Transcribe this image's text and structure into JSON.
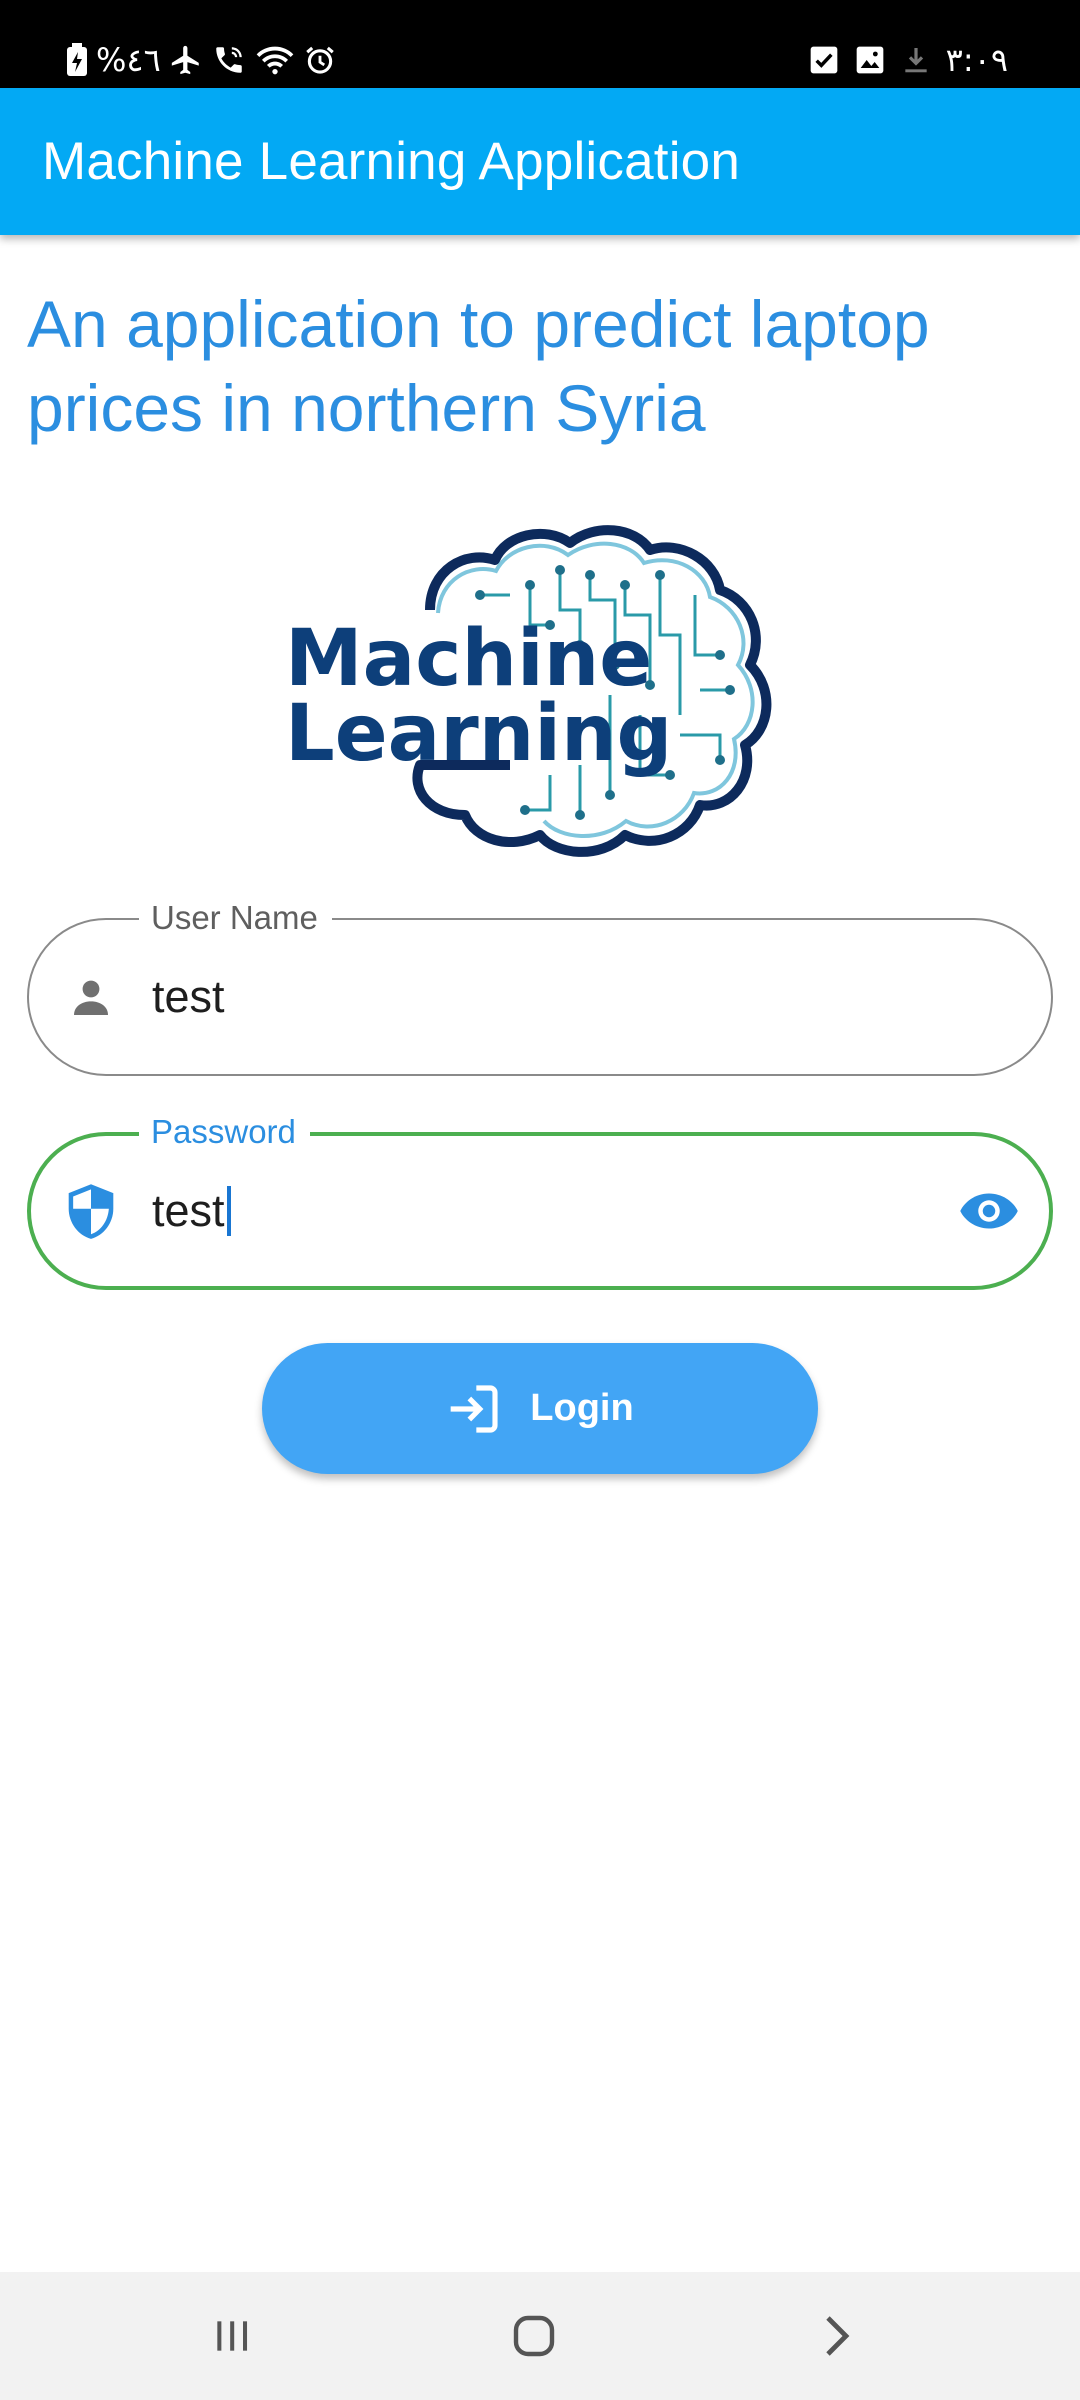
{
  "status_bar": {
    "battery_percent": "%٤٦",
    "time": "٣:٠٩",
    "left_icons": [
      "battery-charging-icon",
      "airplane-icon",
      "wifi-calling-icon",
      "wifi-icon",
      "alarm-icon"
    ],
    "right_icons": [
      "checkbox-notification-icon",
      "image-notification-icon",
      "download-notification-icon"
    ]
  },
  "app_bar": {
    "title": "Machine Learning Application",
    "color": "#03a9f4"
  },
  "intro": {
    "heading": "An application to predict laptop prices in northern Syria",
    "color": "#2b8ee0"
  },
  "logo": {
    "line1": "Machine",
    "line2": "Learning"
  },
  "form": {
    "username": {
      "label": "User Name",
      "value": "test",
      "icon": "person-icon"
    },
    "password": {
      "label": "Password",
      "value": "test",
      "icon": "shield-icon",
      "toggle_icon": "eye-icon",
      "focused": true,
      "border_color": "#4caf50"
    },
    "login": {
      "label": "Login",
      "icon": "login-icon",
      "color": "#42a5f5"
    }
  },
  "nav_bar": {
    "buttons": [
      "recent-apps-icon",
      "home-icon",
      "back-icon"
    ]
  }
}
